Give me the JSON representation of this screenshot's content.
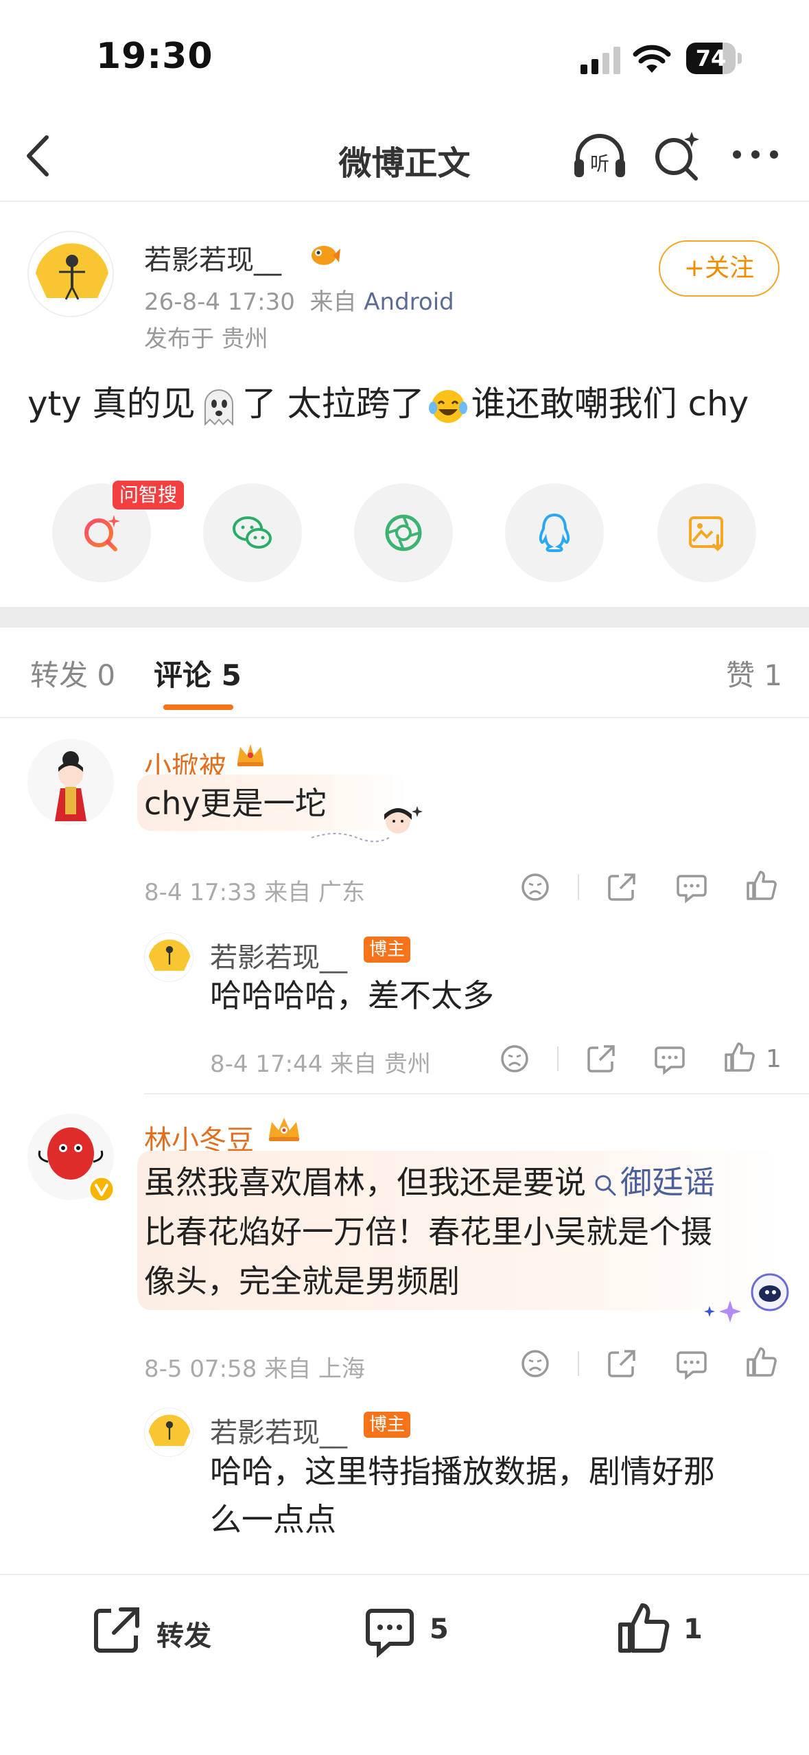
{
  "status_bar": {
    "time": "19:30",
    "battery": "74",
    "battery_level_pct": 74
  },
  "nav": {
    "title": "微博正文"
  },
  "post": {
    "username": "若影若现__",
    "time": "26-8-4 17:30",
    "source_prefix": "来自",
    "source": "Android",
    "location": "发布于 贵州",
    "follow_label": "+关注",
    "text_parts": [
      "yty 真的见",
      "了 太拉跨了",
      "谁还敢嘲我们 chy"
    ],
    "ai_badge": "问智搜"
  },
  "tabs": {
    "repost": "转发 0",
    "comments": "评论 5",
    "likes": "赞 1"
  },
  "comments": [
    {
      "name": "小掀被",
      "text": "chy更是一坨",
      "meta": "8-4 17:33 来自 广东",
      "reply": {
        "name": "若影若现__",
        "badge": "博主",
        "text": "哈哈哈哈，差不太多",
        "meta": "8-4 17:44 来自 贵州",
        "likes": "1"
      }
    },
    {
      "name": "林小冬豆",
      "text_line1": "虽然我喜欢眉林，但我还是要说",
      "topic": "御廷谣",
      "text_line2": "比春花焰好一万倍！春花里小吴就是个摄",
      "text_line3": "像头，完全就是男频剧",
      "meta": "8-5 07:58 来自 上海",
      "reply": {
        "name": "若影若现__",
        "badge": "博主",
        "text_line1": "哈哈，这里特指播放数据，剧情好那",
        "text_line2": "么一点点"
      }
    }
  ],
  "bottom_bar": {
    "repost_label": "转发",
    "comment_count": "5",
    "like_count": "1"
  },
  "colors": {
    "accent": "#f5731b",
    "follow": "#f5a623",
    "link": "#4a5f9b"
  }
}
